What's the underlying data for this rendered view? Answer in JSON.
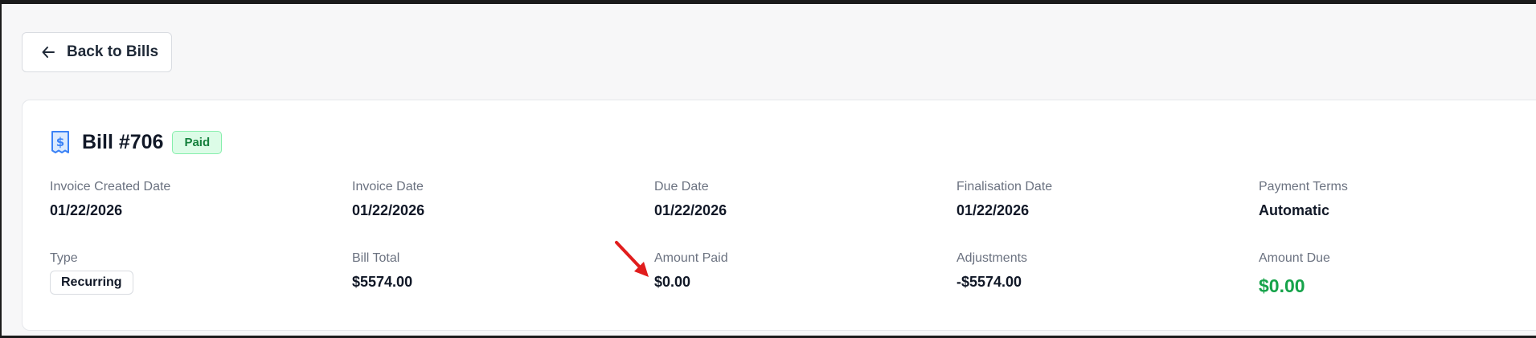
{
  "back_button": {
    "label": "Back to Bills",
    "icon": "arrow-left-icon"
  },
  "bill": {
    "title": "Bill #706",
    "status": "Paid",
    "icon": "dollar-receipt-icon"
  },
  "fields_row1": [
    {
      "label": "Invoice Created Date",
      "value": "01/22/2026"
    },
    {
      "label": "Invoice Date",
      "value": "01/22/2026"
    },
    {
      "label": "Due Date",
      "value": "01/22/2026"
    },
    {
      "label": "Finalisation Date",
      "value": "01/22/2026"
    },
    {
      "label": "Payment Terms",
      "value": "Automatic"
    }
  ],
  "fields_row2": [
    {
      "label": "Type",
      "value": "Recurring"
    },
    {
      "label": "Bill Total",
      "value": "$5574.00"
    },
    {
      "label": "Amount Paid",
      "value": "$0.00"
    },
    {
      "label": "Adjustments",
      "value": "-$5574.00"
    },
    {
      "label": "Amount Due",
      "value": "$0.00"
    }
  ],
  "colors": {
    "accent_green": "#16a34a",
    "badge_bg": "#dcfce7",
    "icon_blue": "#3b82f6",
    "annotation_red": "#e11d1d"
  }
}
